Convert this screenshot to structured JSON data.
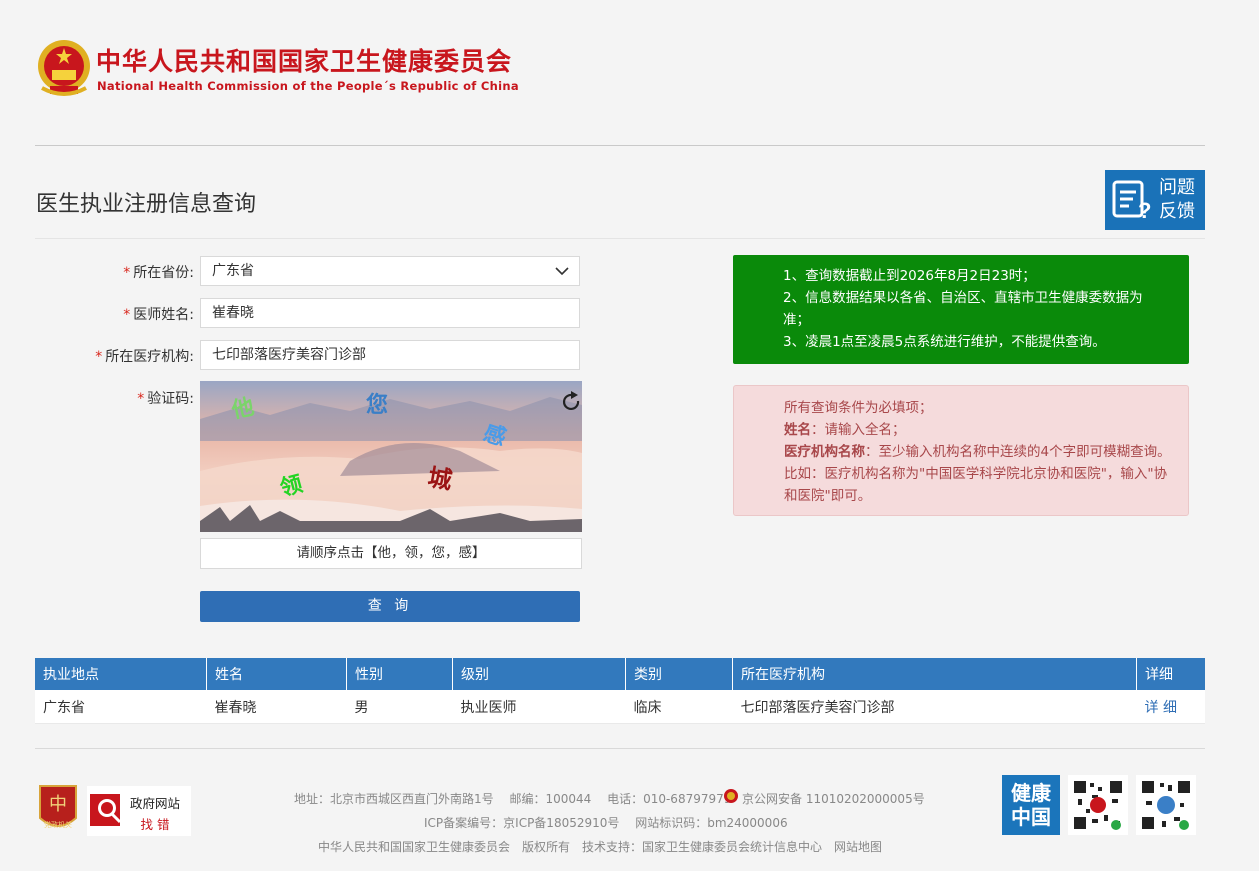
{
  "header": {
    "title_cn": "中华人民共和国国家卫生健康委员会",
    "title_en": "National Health Commission of the People´s Republic of China"
  },
  "page_title": "医生执业注册信息查询",
  "feedback": {
    "line1": "问题",
    "line2": "反馈"
  },
  "form": {
    "province_label": "所在省份:",
    "province_value": "广东省",
    "name_label": "医师姓名:",
    "name_value": "崔春晓",
    "org_label": "所在医疗机构:",
    "org_value": "七印部落医疗美容门诊部",
    "captcha_label": "验证码:",
    "required_mark": "*",
    "captcha_chars": [
      "他",
      "您",
      "感",
      "领",
      "城"
    ],
    "captcha_hint": "请顺序点击【他，领，您，感】",
    "query_button": "查 询"
  },
  "notice_green": {
    "line1": "1、查询数据截止到2026年8月2日23时；",
    "line2": "2、信息数据结果以各省、自治区、直辖市卫生健康委数据为准；",
    "line3": "3、凌晨1点至凌晨5点系统进行维护，不能提供查询。"
  },
  "notice_pink": {
    "line1": "所有查询条件为必填项；",
    "name_key": "姓名",
    "name_text": "：请输入全名；",
    "org_key": "医疗机构名称",
    "org_text": "：至少输入机构名称中连续的4个字即可模糊查询。比如：医疗机构名称为\"中国医学科学院北京协和医院\"，输入\"协和医院\"即可。"
  },
  "table": {
    "headers": [
      "执业地点",
      "姓名",
      "性别",
      "级别",
      "类别",
      "所在医疗机构",
      "详细"
    ],
    "rows": [
      [
        "广东省",
        "崔春晓",
        "男",
        "执业医师",
        "临床",
        "七印部落医疗美容门诊部",
        "详 细"
      ]
    ]
  },
  "footer": {
    "badge1": "党政机关",
    "badge2_line1": "政府网站",
    "badge2_line2": "找 错",
    "line1": "地址：北京市西城区西直门外南路1号　 邮编：100044　 电话：010-68797979",
    "police": "京公网安备 11010202000005号",
    "line2": "ICP备案编号：京ICP备18052910号　 网站标识码：bm24000006",
    "line3": "中华人民共和国国家卫生健康委员会　版权所有　技术支持：国家卫生健康委员会统计信息中心　网站地图",
    "health_logo": "健康中国"
  },
  "colors": {
    "brand_red": "#c8161d",
    "primary_blue": "#2f6eb5",
    "notice_green": "#0a8a0a",
    "notice_pink": "#f5dbdc"
  }
}
